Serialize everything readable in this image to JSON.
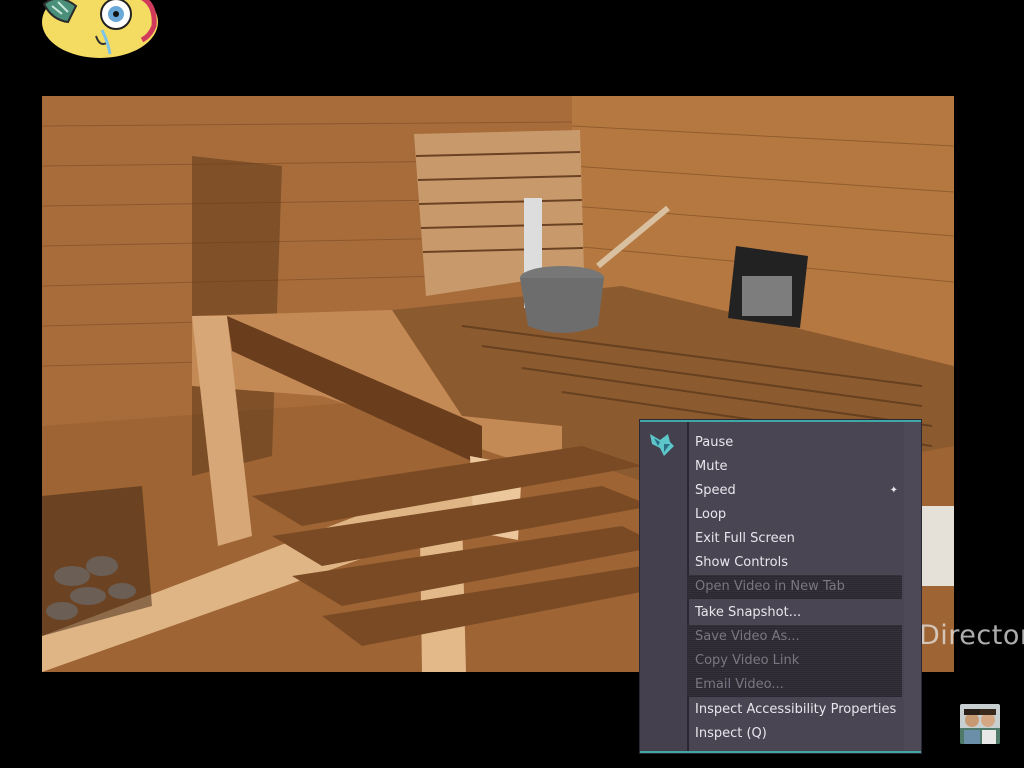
{
  "video": {
    "watermark": "Director"
  },
  "context_menu": {
    "items": [
      {
        "label": "Pause",
        "enabled": true
      },
      {
        "label": "Mute",
        "enabled": true
      },
      {
        "label": "Speed",
        "enabled": true,
        "submenu": true
      },
      {
        "label": "Loop",
        "enabled": true
      },
      {
        "label": "Exit Full Screen",
        "enabled": true
      },
      {
        "label": "Show Controls",
        "enabled": true
      },
      {
        "label": "Open Video in New Tab",
        "enabled": false
      },
      {
        "label": "Take Snapshot...",
        "enabled": true
      },
      {
        "label": "Save Video As...",
        "enabled": false
      },
      {
        "label": "Copy Video Link",
        "enabled": false
      },
      {
        "label": "Email Video...",
        "enabled": false
      },
      {
        "label": "Inspect Accessibility Properties",
        "enabled": true
      },
      {
        "label": "Inspect (Q)",
        "enabled": true
      }
    ],
    "submenu_arrow": "✦"
  },
  "colors": {
    "menu_bg": "#4a4553",
    "menu_accent": "#3fa7a6",
    "menu_text": "#e8e6ec",
    "menu_text_disabled": "#7a7784"
  },
  "icons": {
    "menu_logo": "wolf-logo-icon",
    "avatar": "cartoon-avatar",
    "thumbnail": "user-thumbnail"
  }
}
